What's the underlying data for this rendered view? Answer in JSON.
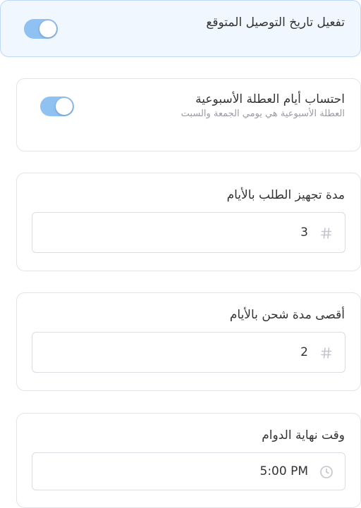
{
  "estimated_delivery": {
    "label": "تفعيل تاريخ التوصيل المتوقع",
    "enabled": true
  },
  "weekend": {
    "label": "احتساب أيام العطلة الأسبوعية",
    "description": "العطلة الأسبوعية هي يومي الجمعة والسبت",
    "enabled": true
  },
  "prep_days": {
    "label": "مدة تجهيز الطلب بالأيام",
    "value": "3",
    "icon": "hash-icon"
  },
  "max_shipping_days": {
    "label": "أقصى مدة شحن بالأيام",
    "value": "2",
    "icon": "hash-icon"
  },
  "end_of_work": {
    "label": "وقت نهاية الدوام",
    "value": "5:00 PM",
    "icon": "clock-icon"
  },
  "colors": {
    "toggle_on": "#90c1f3",
    "highlight_bg": "#f1f7fe",
    "highlight_border": "#bcd8f6"
  }
}
